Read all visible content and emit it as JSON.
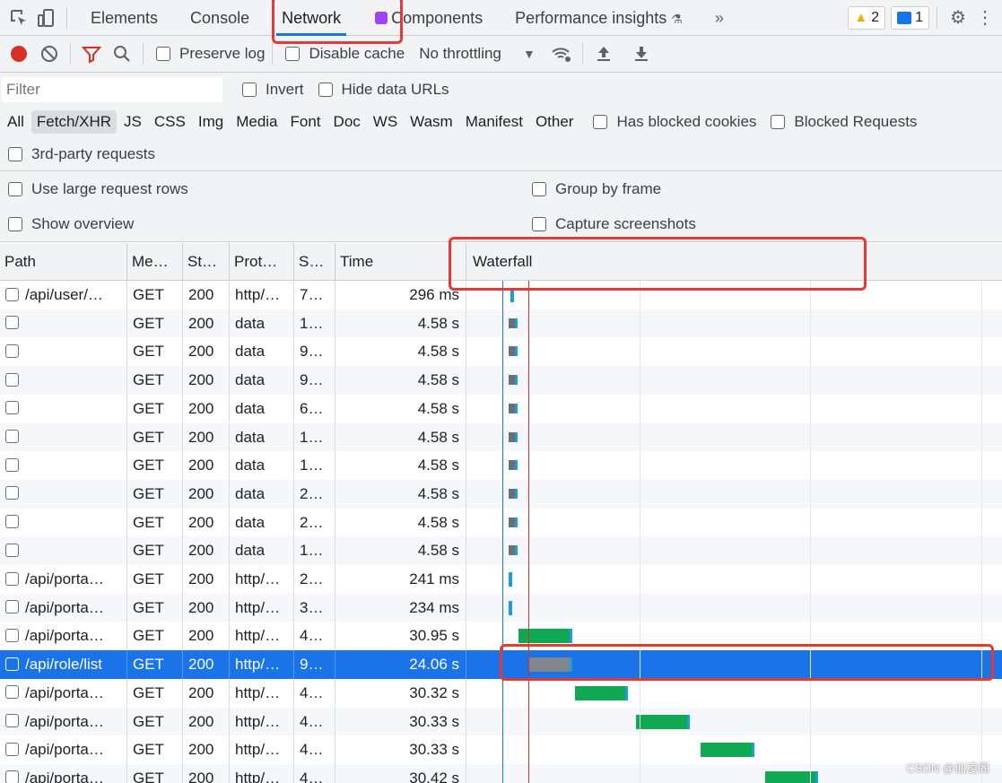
{
  "tabs": [
    {
      "label": "Elements"
    },
    {
      "label": "Console"
    },
    {
      "label": "Network",
      "active": true
    },
    {
      "label": "Components"
    },
    {
      "label": "Performance insights"
    }
  ],
  "more_tabs": "»",
  "warnings_count": "2",
  "messages_count": "1",
  "toolbar": {
    "preserve_log": "Preserve log",
    "disable_cache": "Disable cache",
    "throttling": "No throttling"
  },
  "filter": {
    "placeholder": "Filter",
    "invert": "Invert",
    "hide_data_urls": "Hide data URLs"
  },
  "types": [
    "All",
    "Fetch/XHR",
    "JS",
    "CSS",
    "Img",
    "Media",
    "Font",
    "Doc",
    "WS",
    "Wasm",
    "Manifest",
    "Other"
  ],
  "selected_type": "Fetch/XHR",
  "has_blocked_cookies": "Has blocked cookies",
  "blocked_requests": "Blocked Requests",
  "third_party": "3rd-party requests",
  "settings": {
    "large_rows": "Use large request rows",
    "group_by_frame": "Group by frame",
    "show_overview": "Show overview",
    "capture_screenshots": "Capture screenshots"
  },
  "columns": {
    "path": "Path",
    "method": "Me…",
    "status": "St…",
    "protocol": "Prot…",
    "size": "S…",
    "time": "Time",
    "waterfall": "Waterfall"
  },
  "rows": [
    {
      "path": "/api/user/…",
      "method": "GET",
      "status": "200",
      "protocol": "http/…",
      "size": "7…",
      "time": "296 ms",
      "wf_start": 0.015,
      "wf_len": 0.006,
      "kind": "tiny"
    },
    {
      "path": "",
      "method": "GET",
      "status": "200",
      "protocol": "data",
      "size": "1…",
      "time": "4.58 s",
      "wf_start": 0.012,
      "wf_len": 0.016,
      "kind": "data"
    },
    {
      "path": "",
      "method": "GET",
      "status": "200",
      "protocol": "data",
      "size": "9…",
      "time": "4.58 s",
      "wf_start": 0.012,
      "wf_len": 0.016,
      "kind": "data"
    },
    {
      "path": "",
      "method": "GET",
      "status": "200",
      "protocol": "data",
      "size": "9…",
      "time": "4.58 s",
      "wf_start": 0.012,
      "wf_len": 0.016,
      "kind": "data"
    },
    {
      "path": "",
      "method": "GET",
      "status": "200",
      "protocol": "data",
      "size": "6…",
      "time": "4.58 s",
      "wf_start": 0.012,
      "wf_len": 0.016,
      "kind": "data"
    },
    {
      "path": "",
      "method": "GET",
      "status": "200",
      "protocol": "data",
      "size": "1…",
      "time": "4.58 s",
      "wf_start": 0.012,
      "wf_len": 0.016,
      "kind": "data"
    },
    {
      "path": "",
      "method": "GET",
      "status": "200",
      "protocol": "data",
      "size": "1…",
      "time": "4.58 s",
      "wf_start": 0.012,
      "wf_len": 0.016,
      "kind": "data"
    },
    {
      "path": "",
      "method": "GET",
      "status": "200",
      "protocol": "data",
      "size": "2…",
      "time": "4.58 s",
      "wf_start": 0.012,
      "wf_len": 0.016,
      "kind": "data"
    },
    {
      "path": "",
      "method": "GET",
      "status": "200",
      "protocol": "data",
      "size": "2…",
      "time": "4.58 s",
      "wf_start": 0.012,
      "wf_len": 0.016,
      "kind": "data"
    },
    {
      "path": "",
      "method": "GET",
      "status": "200",
      "protocol": "data",
      "size": "1…",
      "time": "4.58 s",
      "wf_start": 0.012,
      "wf_len": 0.016,
      "kind": "data"
    },
    {
      "path": "/api/porta…",
      "method": "GET",
      "status": "200",
      "protocol": "http/…",
      "size": "2…",
      "time": "241 ms",
      "wf_start": 0.012,
      "wf_len": 0.006,
      "kind": "tiny"
    },
    {
      "path": "/api/porta…",
      "method": "GET",
      "status": "200",
      "protocol": "http/…",
      "size": "3…",
      "time": "234 ms",
      "wf_start": 0.012,
      "wf_len": 0.006,
      "kind": "tiny"
    },
    {
      "path": "/api/porta…",
      "method": "GET",
      "status": "200",
      "protocol": "http/…",
      "size": "4…",
      "time": "30.95 s",
      "wf_start": 0.03,
      "wf_len": 0.1,
      "kind": "green"
    },
    {
      "path": "/api/role/list",
      "method": "GET",
      "status": "200",
      "protocol": "http/…",
      "size": "9…",
      "time": "24.06 s",
      "wf_start": 0.05,
      "wf_len": 0.08,
      "kind": "gray",
      "selected": true
    },
    {
      "path": "/api/porta…",
      "method": "GET",
      "status": "200",
      "protocol": "http/…",
      "size": "4…",
      "time": "30.32 s",
      "wf_start": 0.135,
      "wf_len": 0.1,
      "kind": "green"
    },
    {
      "path": "/api/porta…",
      "method": "GET",
      "status": "200",
      "protocol": "http/…",
      "size": "4…",
      "time": "30.33 s",
      "wf_start": 0.25,
      "wf_len": 0.1,
      "kind": "green"
    },
    {
      "path": "/api/porta…",
      "method": "GET",
      "status": "200",
      "protocol": "http/…",
      "size": "4…",
      "time": "30.33 s",
      "wf_start": 0.37,
      "wf_len": 0.1,
      "kind": "green"
    },
    {
      "path": "/api/porta…",
      "method": "GET",
      "status": "200",
      "protocol": "http/…",
      "size": "4…",
      "time": "30.42 s",
      "wf_start": 0.49,
      "wf_len": 0.1,
      "kind": "green"
    }
  ],
  "colors": {
    "accent": "#1a73e8",
    "record": "#d93025",
    "annotation": "#e53935",
    "green": "#0fa853",
    "gray": "#80868b",
    "receive": "#1a9fd9"
  },
  "watermark": "CSDN @仙凌阁"
}
